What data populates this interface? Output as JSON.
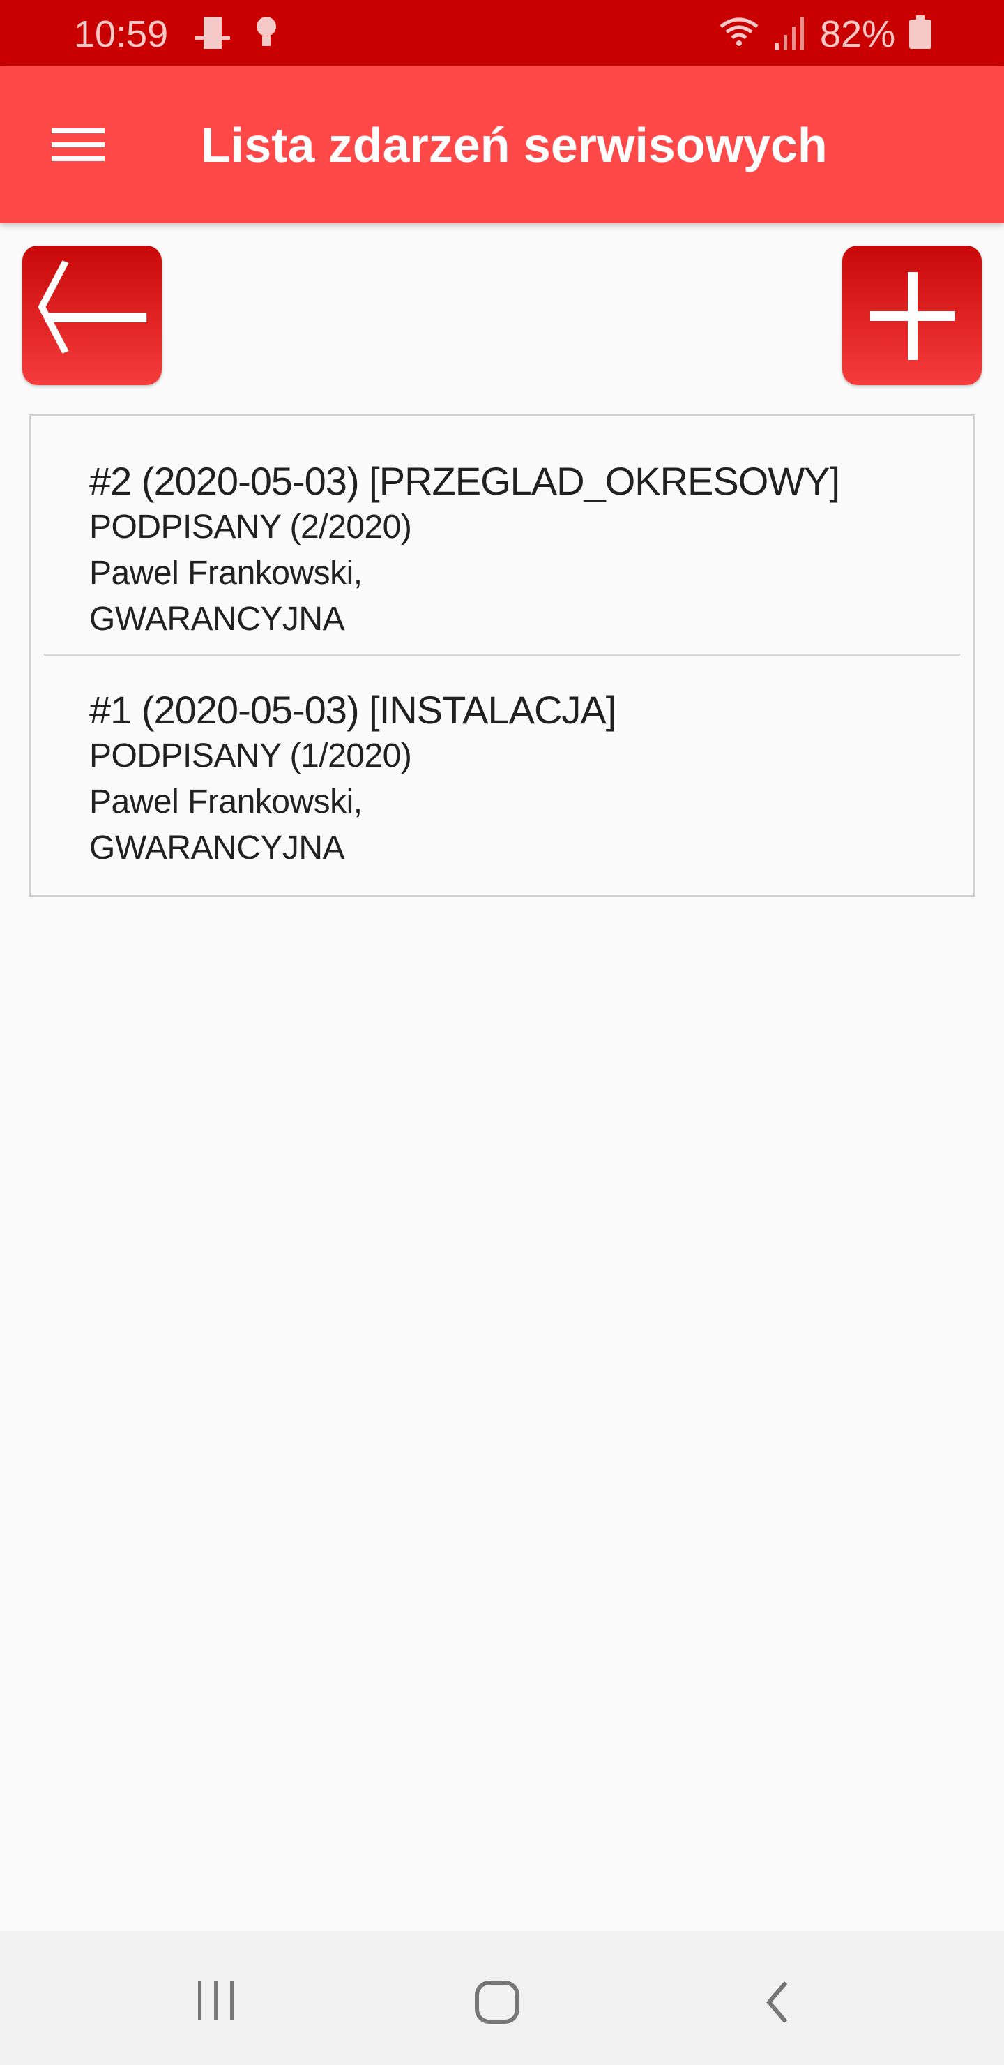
{
  "status_bar": {
    "time": "10:59",
    "battery": "82%"
  },
  "toolbar": {
    "title": "Lista zdarzeń serwisowych"
  },
  "colors": {
    "status_bar": "#c80000",
    "toolbar": "#ff4848",
    "button": "#e41e1e"
  },
  "events": [
    {
      "title": "#2 (2020-05-03) [PRZEGLAD_OKRESOWY]",
      "status": "PODPISANY (2/2020)",
      "person": "Pawel Frankowski,",
      "type": "GWARANCYJNA"
    },
    {
      "title": "#1 (2020-05-03) [INSTALACJA]",
      "status": "PODPISANY (1/2020)",
      "person": "Pawel Frankowski,",
      "type": "GWARANCYJNA"
    }
  ]
}
